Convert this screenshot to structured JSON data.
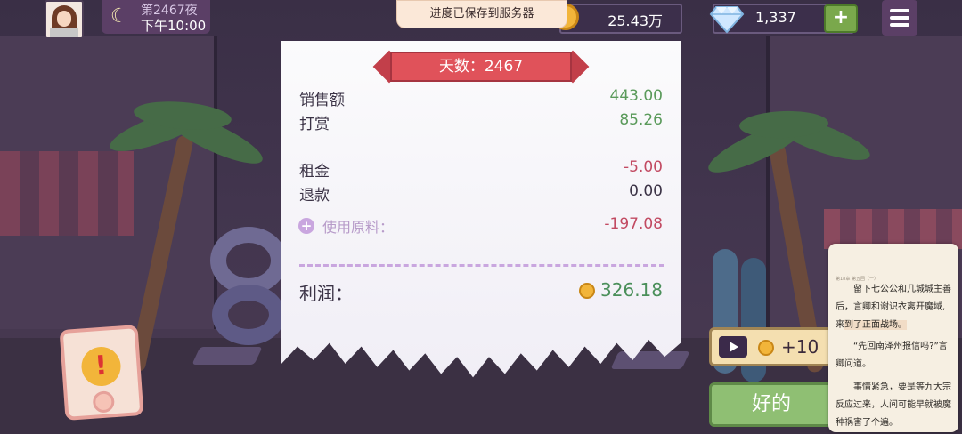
{
  "header": {
    "day_label": "第2467夜",
    "time_label": "下午10:00",
    "toast": "进度已保存到服务器",
    "coins": "25.43万",
    "gems": "1,337",
    "plus_label": "+"
  },
  "receipt": {
    "title": "天数：2467",
    "rows": [
      {
        "label": "销售额",
        "value": "443.00",
        "tone": "green"
      },
      {
        "label": "打赏",
        "value": "85.26",
        "tone": "green"
      },
      {
        "label": "租金",
        "value": "-5.00",
        "tone": "red"
      },
      {
        "label": "退款",
        "value": "0.00",
        "tone": "dark"
      }
    ],
    "ingredients": {
      "label": "使用原料：",
      "value": "-197.08"
    },
    "profit": {
      "label": "利润：",
      "value": "326.18"
    }
  },
  "reward": {
    "value": "+10"
  },
  "ok_button": "好的",
  "reader": {
    "header": "第18章 第五回（一）",
    "para1_a": "留下七公公和几城城主善后，言卿和谢识衣离开魔域,来",
    "para1_b": "到了正面战场。",
    "para2": "“先回南泽州报信吗?”言卿问道。",
    "para3": "事情紧急，要是等九大宗反应过来，人间可能早就被魔种祸害了个遍。"
  },
  "icons": [
    "moon-icon",
    "coin-icon",
    "diamond-icon",
    "plus-icon",
    "menu-icon",
    "play-icon",
    "alert-icon"
  ],
  "colors": {
    "profit_green": "#4a8f5a",
    "negative_red": "#c24a62",
    "ribbon_red": "#e0525a",
    "ok_green": "#8fbf73"
  }
}
